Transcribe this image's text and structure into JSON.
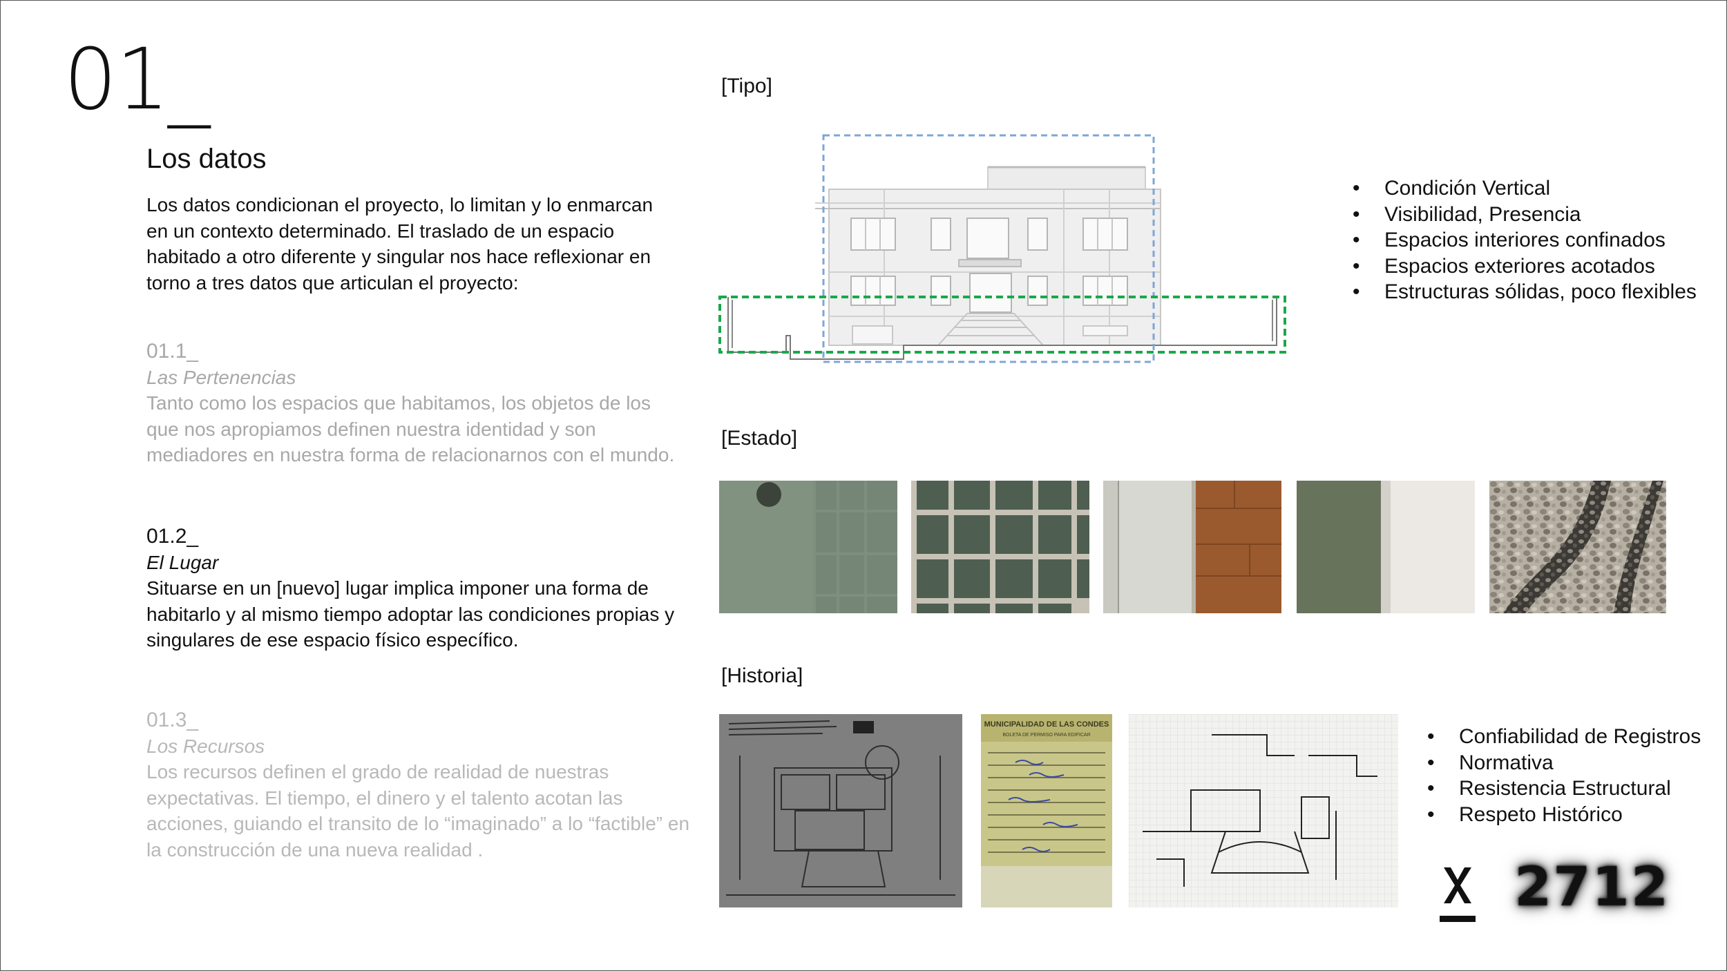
{
  "section": {
    "number": "01_",
    "title": "Los datos",
    "intro": "Los datos condicionan el proyecto, lo limitan y lo enmarcan en un contexto determinado. El traslado de un espacio habitado a otro diferente y singular nos hace reflexionar en torno a tres datos que articulan el proyecto:"
  },
  "subsections": [
    {
      "number": "01.1_",
      "title": "Las Pertenencias",
      "text": "Tanto como los espacios que habitamos, los objetos de los que nos apropiamos definen nuestra identidad y son mediadores en nuestra forma de relacionarnos con el mundo."
    },
    {
      "number": "01.2_",
      "title": "El Lugar",
      "text": "Situarse en un [nuevo] lugar implica imponer una forma de habitarlo y al mismo tiempo adoptar las condiciones propias y singulares de ese espacio físico específico."
    },
    {
      "number": "01.3_",
      "title": "Los Recursos",
      "text": "Los recursos definen el grado de realidad de nuestras expectativas. El tiempo, el dinero y el talento acotan las acciones, guiando el transito de lo “imaginado” a lo “factible” en la construcción de una nueva realidad ."
    }
  ],
  "tipo": {
    "label": "[Tipo]",
    "bullets": [
      "Condición Vertical",
      "Visibilidad, Presencia",
      "Espacios interiores confinados",
      "Espacios exteriores acotados",
      "Estructuras sólidas, poco flexibles"
    ]
  },
  "estado": {
    "label": "[Estado]",
    "photos": [
      "green-tile-floor",
      "green-grid-tiles",
      "concrete-and-wood",
      "green-stone-and-plaster",
      "pebble-mosaic"
    ]
  },
  "historia": {
    "label": "[Historia]",
    "photos": [
      "floor-plan-blueprint",
      "municipal-permit-document",
      "hand-drawn-plan-sketch"
    ],
    "bullets": [
      "Confiabilidad de Registros",
      "Normativa",
      "Resistencia Estructural",
      "Respeto Histórico"
    ]
  },
  "footer": {
    "logo_letter": "x",
    "seal": "2712"
  },
  "colors": {
    "text": "#111111",
    "faded_text": "#a8a8a8",
    "blue_dashed": "#7fa6d6",
    "green_dashed": "#1aa84a"
  }
}
